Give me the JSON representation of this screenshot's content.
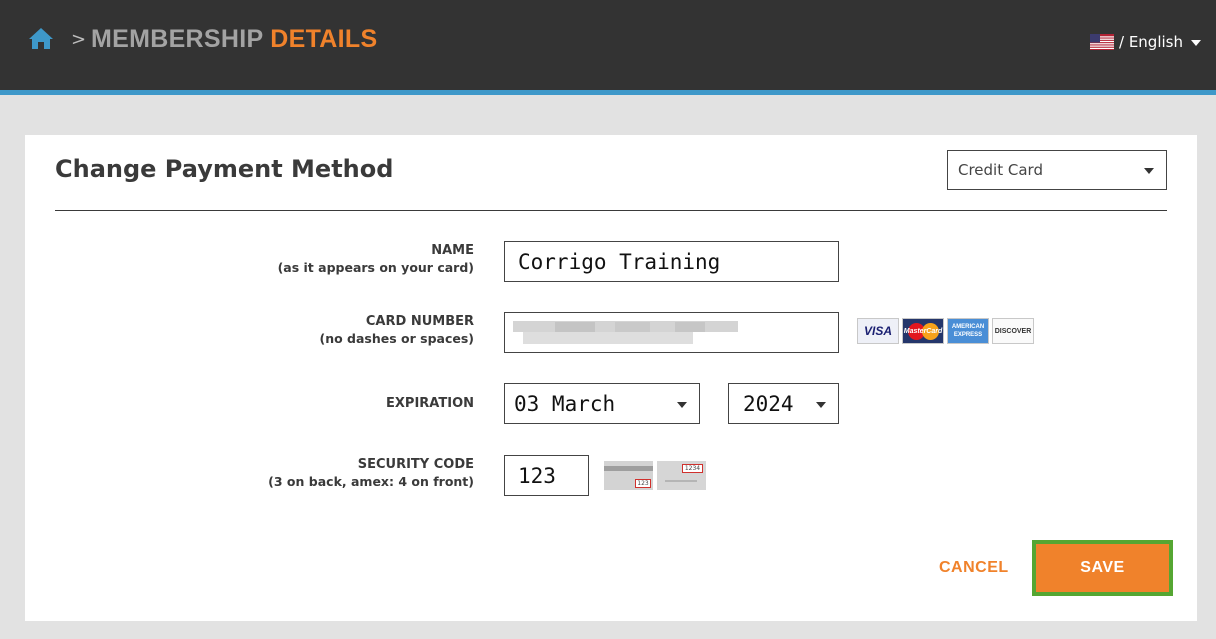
{
  "header": {
    "home_icon": "home-icon",
    "separator": ">",
    "title_main": "MEMBERSHIP",
    "title_accent": "DETAILS",
    "language": "/ English",
    "colors": {
      "bar": "#333333",
      "accent_line": "#3e98c9",
      "title_accent": "#f0822b"
    }
  },
  "form": {
    "heading": "Change Payment Method",
    "payment_method": {
      "selected": "Credit Card"
    },
    "name": {
      "label": "NAME",
      "sublabel": "(as it appears on your card)",
      "value": "Corrigo Training"
    },
    "card_number": {
      "label": "CARD NUMBER",
      "sublabel": "(no dashes or spaces)",
      "value_state": "obscured",
      "logos": [
        "VISA",
        "MasterCard",
        "AMERICAN EXPRESS",
        "DISCOVER"
      ]
    },
    "expiration": {
      "label": "EXPIRATION",
      "month": "03 March",
      "year": "2024"
    },
    "security_code": {
      "label": "SECURITY CODE",
      "sublabel": "(3 on back, amex: 4 on front)",
      "value": "123",
      "back_hint": "123",
      "front_hint": "1234"
    }
  },
  "actions": {
    "cancel": "CANCEL",
    "save": "SAVE",
    "colors": {
      "primary": "#f0822b",
      "focus_border": "#55a632"
    }
  }
}
